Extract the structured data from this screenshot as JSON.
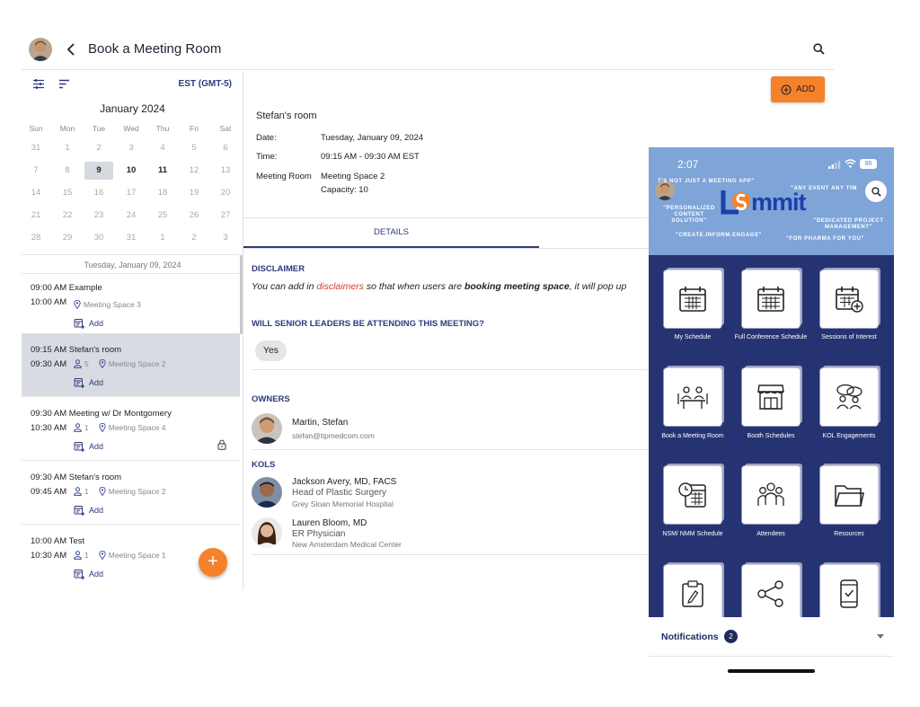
{
  "header": {
    "title": "Book a Meeting Room"
  },
  "calendar": {
    "timezone": "EST (GMT-5)",
    "month": "January 2024",
    "weekdays": [
      "Sun",
      "Mon",
      "Tue",
      "Wed",
      "Thu",
      "Fri",
      "Sat"
    ],
    "weeks": [
      [
        "31",
        "1",
        "2",
        "3",
        "4",
        "5",
        "6"
      ],
      [
        "7",
        "8",
        "9",
        "10",
        "11",
        "12",
        "13"
      ],
      [
        "14",
        "15",
        "16",
        "17",
        "18",
        "19",
        "20"
      ],
      [
        "21",
        "22",
        "23",
        "24",
        "25",
        "26",
        "27"
      ],
      [
        "28",
        "29",
        "30",
        "31",
        "1",
        "2",
        "3"
      ]
    ],
    "selected_date": "Tuesday, January 09, 2024"
  },
  "events": [
    {
      "start": "09:00 AM",
      "end": "10:00 AM",
      "title": "Example",
      "attendees": "",
      "room": "Meeting Space 3",
      "add": "Add",
      "locked": false
    },
    {
      "start": "09:15 AM",
      "end": "09:30 AM",
      "title": "Stefan's room",
      "attendees": "5",
      "room": "Meeting Space 2",
      "add": "Add",
      "locked": false
    },
    {
      "start": "09:30 AM",
      "end": "10:30 AM",
      "title": "Meeting w/ Dr Montgomery",
      "attendees": "1",
      "room": "Meeting Space 4",
      "add": "Add",
      "locked": true
    },
    {
      "start": "09:30 AM",
      "end": "09:45 AM",
      "title": "Stefan's room",
      "attendees": "1",
      "room": "Meeting Space 2",
      "add": "Add",
      "locked": false
    },
    {
      "start": "10:00 AM",
      "end": "10:30 AM",
      "title": "Test",
      "attendees": "1",
      "room": "Meeting Space 1",
      "add": "Add",
      "locked": false
    }
  ],
  "detail": {
    "add_label": "ADD",
    "room_title": "Stefan's room",
    "date_label": "Date:",
    "date_value": "Tuesday, January 09, 2024",
    "time_label": "Time:",
    "time_value": "09:15 AM - 09:30 AM EST",
    "room_label": "Meeting Room",
    "room_value": "Meeting Space 2",
    "capacity": "Capacity: 10",
    "tab": "DETAILS",
    "disclaimer_heading": "DISCLAIMER",
    "disclaimer_p1": "You can add in ",
    "disclaimer_link": "disclaimers",
    "disclaimer_p2": " so that when users are ",
    "disclaimer_bold": "booking meeting space",
    "disclaimer_p3": ", it will pop up",
    "question": "WILL SENIOR LEADERS BE ATTENDING THIS MEETING?",
    "answer": "Yes",
    "owners_heading": "OWNERS",
    "owners": [
      {
        "name": "Martin, Stefan",
        "email": "stefan@tipmedcom.com"
      }
    ],
    "kols_heading": "KOLS",
    "kols": [
      {
        "name": "Jackson Avery,  MD, FACS",
        "title": "Head of Plastic Surgery",
        "org": "Grey Sloan Memorial Hospital"
      },
      {
        "name": "Lauren Bloom,  MD",
        "title": "ER Physician",
        "org": "New Amsterdam Medical Center"
      }
    ]
  },
  "phone": {
    "time": "2:07",
    "battery": "85",
    "brand": "Summit",
    "tags": {
      "t1": "T'S NOT JUST A MEETING APP\"",
      "t2": "\"ANY EVENT ANY TIM",
      "t3": "\"PERSONALIZED CONTENT SOLUTION\"",
      "t4": "\"DEDICATED PROJECT MANAGEMENT\"",
      "t5": "\"CREATE.INFORM.ENGAGE\"",
      "t6": "\"FOR PHARMA FOR YOU\""
    },
    "tiles": [
      {
        "label": "My Schedule",
        "icon": "calendar-icon"
      },
      {
        "label": "Full Conference Schedule",
        "icon": "calendar-grid-icon"
      },
      {
        "label": "Sessions of Interest",
        "icon": "calendar-add-icon"
      },
      {
        "label": "Book a Meeting Room",
        "icon": "meeting-room-icon"
      },
      {
        "label": "Booth Schedules",
        "icon": "booth-icon"
      },
      {
        "label": "KOL Engagements",
        "icon": "kol-chat-icon"
      },
      {
        "label": "NSM/ NMM Schedule",
        "icon": "calendar-clock-icon"
      },
      {
        "label": "Attendees",
        "icon": "attendees-icon"
      },
      {
        "label": "Resources",
        "icon": "folder-icon"
      },
      {
        "label": "",
        "icon": "clipboard-icon"
      },
      {
        "label": "",
        "icon": "share-icon"
      },
      {
        "label": "",
        "icon": "mobile-check-icon"
      }
    ],
    "notifications_label": "Notifications",
    "notifications_count": "2"
  }
}
